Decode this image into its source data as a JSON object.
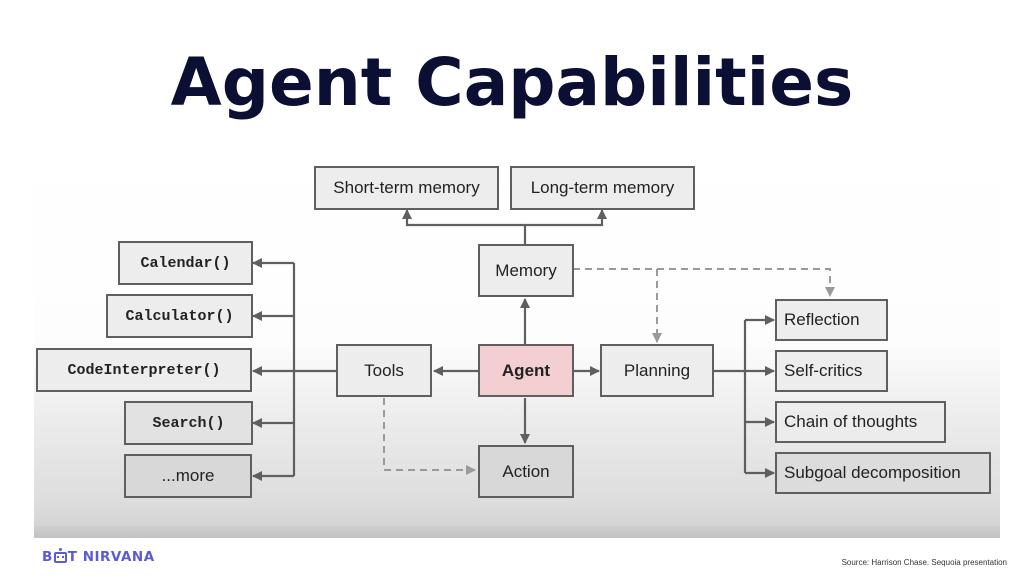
{
  "slide": {
    "title": "Agent Capabilities",
    "source": "Source: Harrison Chase. Sequoia presentation",
    "brand": {
      "prefix": "B",
      "suffix": "T NIRVANA",
      "icon": "robot-icon",
      "color": "#5b5bd6"
    },
    "title_color": "#0a0f33"
  },
  "diagram": {
    "colors": {
      "node_fill": "#ececec",
      "node_border": "#5f5f5f",
      "agent_fill": "#f3cfd1",
      "arrow": "#5f5f5f",
      "dashed_arrow": "#9a9a9a"
    },
    "nodes": {
      "agent": "Agent",
      "memory": "Memory",
      "short_term_memory": "Short-term memory",
      "long_term_memory": "Long-term memory",
      "tools": "Tools",
      "planning": "Planning",
      "action": "Action",
      "tool_items": [
        "Calendar()",
        "Calculator()",
        "CodeInterpreter()",
        "Search()",
        "...more"
      ],
      "planning_items": [
        "Reflection",
        "Self-critics",
        "Chain of thoughts",
        "Subgoal decomposition"
      ]
    },
    "edges": [
      {
        "from": "Agent",
        "to": "Memory",
        "style": "solid"
      },
      {
        "from": "Agent",
        "to": "Tools",
        "style": "solid"
      },
      {
        "from": "Agent",
        "to": "Planning",
        "style": "solid"
      },
      {
        "from": "Agent",
        "to": "Action",
        "style": "solid"
      },
      {
        "from": "Memory",
        "to": "Short-term memory",
        "style": "solid"
      },
      {
        "from": "Memory",
        "to": "Long-term memory",
        "style": "solid"
      },
      {
        "from": "Memory",
        "to": "Planning",
        "style": "dashed"
      },
      {
        "from": "Memory",
        "to": "Reflection",
        "style": "dashed"
      },
      {
        "from": "Tools",
        "to": "Action",
        "style": "dashed"
      },
      {
        "from": "Tools",
        "to": "Calendar()",
        "style": "solid"
      },
      {
        "from": "Tools",
        "to": "Calculator()",
        "style": "solid"
      },
      {
        "from": "Tools",
        "to": "CodeInterpreter()",
        "style": "solid"
      },
      {
        "from": "Tools",
        "to": "Search()",
        "style": "solid"
      },
      {
        "from": "Tools",
        "to": "...more",
        "style": "solid"
      },
      {
        "from": "Planning",
        "to": "Reflection",
        "style": "solid"
      },
      {
        "from": "Planning",
        "to": "Self-critics",
        "style": "solid"
      },
      {
        "from": "Planning",
        "to": "Chain of thoughts",
        "style": "solid"
      },
      {
        "from": "Planning",
        "to": "Subgoal decomposition",
        "style": "solid"
      }
    ]
  }
}
